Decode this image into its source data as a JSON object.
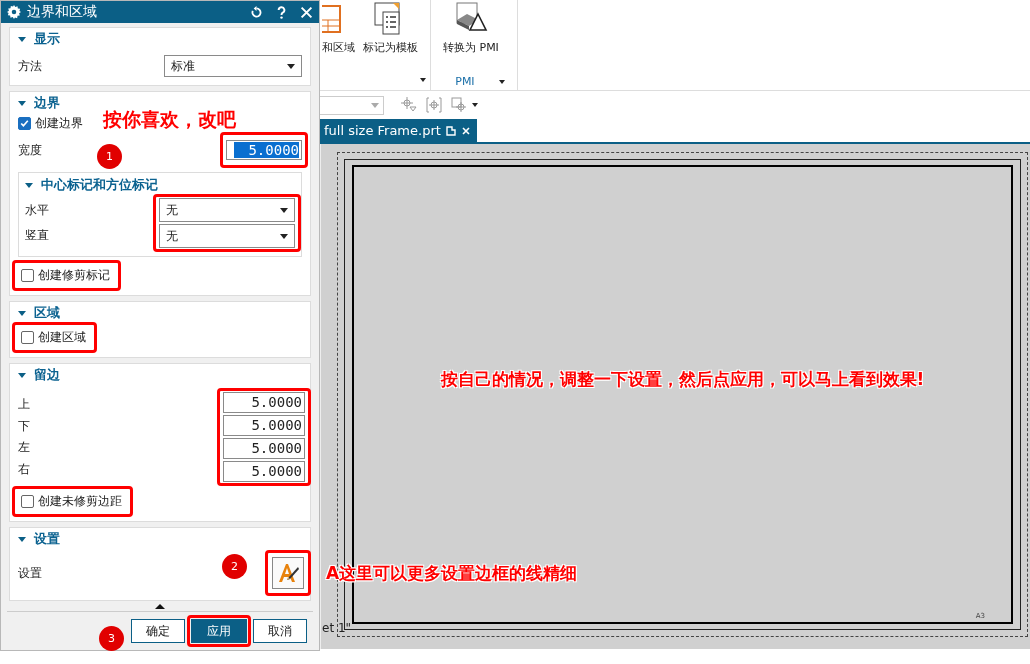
{
  "dialog": {
    "title": "边界和区域",
    "display": {
      "heading": "显示",
      "expanded": true,
      "method_label": "方法",
      "method_value": "标准"
    },
    "border": {
      "heading": "边界",
      "expanded": true,
      "create_border": {
        "label": "创建边界",
        "checked": true
      },
      "width_label": "宽度",
      "width_value": "5.0000",
      "center_marks": {
        "heading": "中心标记和方位标记",
        "expanded": true,
        "fields": [
          {
            "label": "水平",
            "value": "无"
          },
          {
            "label": "竖直",
            "value": "无"
          }
        ]
      },
      "trim_marks": {
        "label": "创建修剪标记",
        "checked": false
      }
    },
    "zones": {
      "heading": "区域",
      "expanded": true,
      "create_zones": {
        "label": "创建区域",
        "checked": false
      }
    },
    "margins": {
      "heading": "留边",
      "expanded": true,
      "fields": [
        {
          "label": "上",
          "value": "5.0000"
        },
        {
          "label": "下",
          "value": "5.0000"
        },
        {
          "label": "左",
          "value": "5.0000"
        },
        {
          "label": "右",
          "value": "5.0000"
        }
      ],
      "untrimmed": {
        "label": "创建未修剪边距",
        "checked": false
      }
    },
    "settings": {
      "heading": "设置",
      "expanded": true,
      "label": "设置"
    },
    "buttons": [
      {
        "label": "确定",
        "selected": false
      },
      {
        "label": "应用",
        "selected": true
      },
      {
        "label": "取消",
        "selected": false
      }
    ]
  },
  "ribbon": {
    "items": [
      {
        "label": "和区域"
      },
      {
        "label": "标记为模板"
      }
    ],
    "pmi_item": "转换为 PMI",
    "pmi_group": "PMI"
  },
  "document_tab": {
    "title": "full size Frame.prt"
  },
  "sheet": {
    "label": "et 1\"",
    "size_label": "A3"
  },
  "annotations": {
    "edit_note": "按你喜欢，改吧",
    "apply_note": "按自己的情况，调整一下设置，然后点应用，可以马上看到效果!",
    "style_note": "A这里可以更多设置边框的线精细"
  },
  "badges": [
    "1",
    "2",
    "3"
  ]
}
